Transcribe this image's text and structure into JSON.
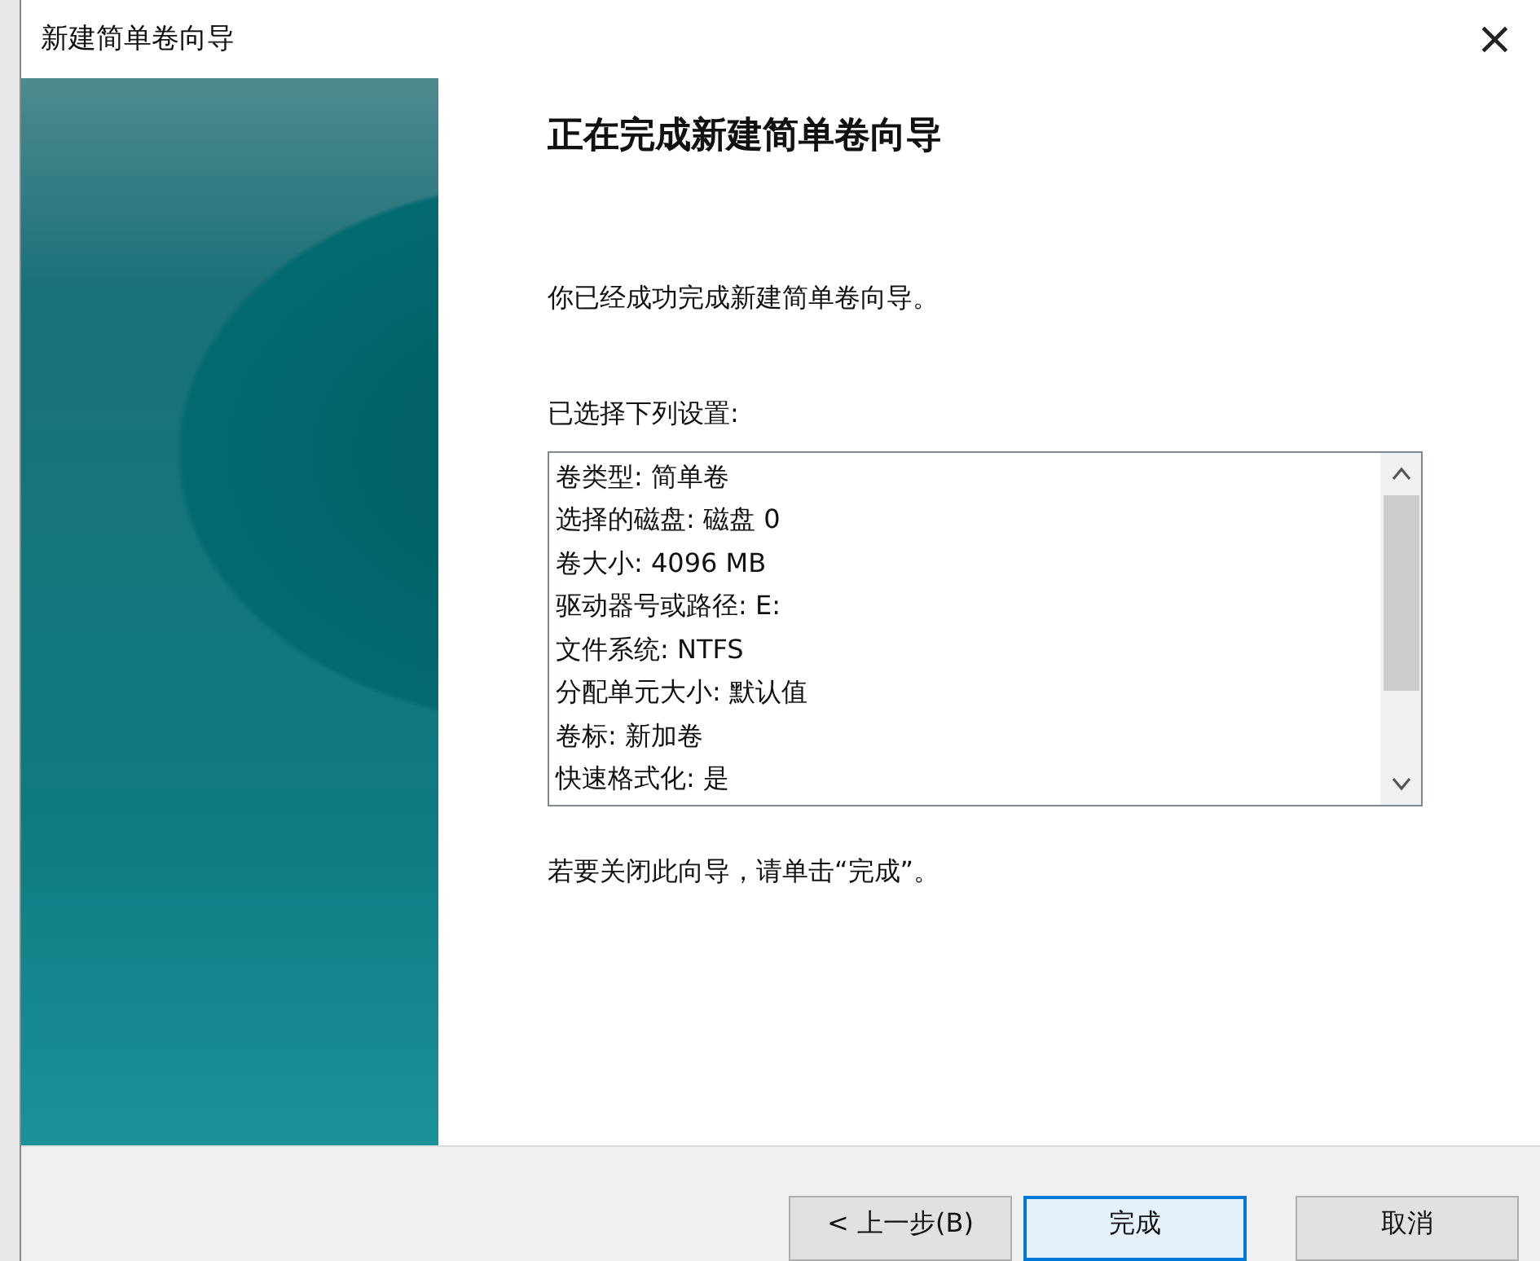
{
  "window": {
    "title": "新建简单卷向导",
    "close": "×"
  },
  "heading": "正在完成新建简单卷向导",
  "intro": "你已经成功完成新建简单卷向导。",
  "settings_label": "已选择下列设置:",
  "settings": [
    "卷类型: 简单卷",
    "选择的磁盘: 磁盘 0",
    "卷大小: 4096 MB",
    "驱动器号或路径: E:",
    "文件系统: NTFS",
    "分配单元大小: 默认值",
    "卷标: 新加卷",
    "快速格式化: 是"
  ],
  "closing_note": "若要关闭此向导，请单击“完成”。",
  "buttons": [
    {
      "label": "< 上一步(B)",
      "kind": "normal"
    },
    {
      "label": "完成",
      "kind": "default"
    },
    {
      "label": "取消",
      "kind": "normal"
    }
  ]
}
